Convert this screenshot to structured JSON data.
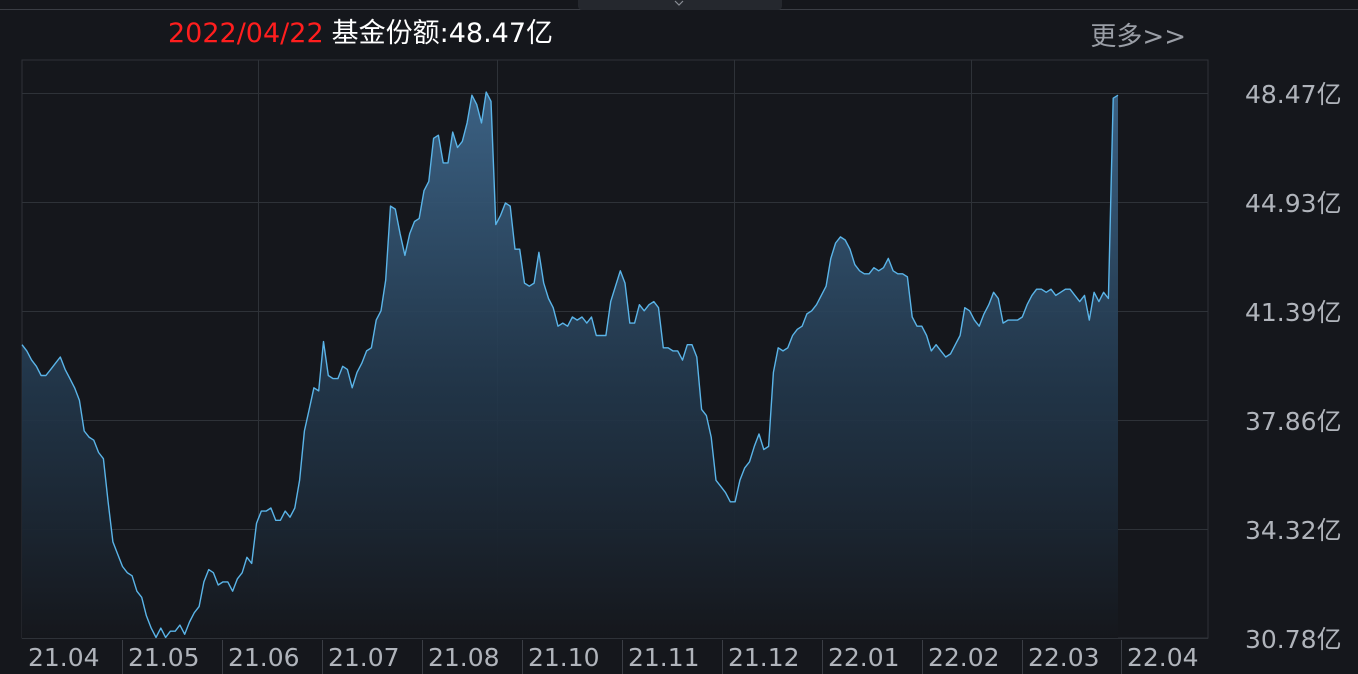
{
  "header": {
    "date": "2022/04/22",
    "label": "基金份额:",
    "value": "48.47亿",
    "more": "更多>>"
  },
  "colors": {
    "line": "#5ab4e8",
    "date": "#ff1e1e",
    "background": "#15171c",
    "grid": "#2e3238"
  },
  "icons": {
    "top_tab": "caret-down-icon"
  },
  "chart_data": {
    "type": "area",
    "title": "",
    "xlabel": "",
    "ylabel": "",
    "unit": "亿",
    "ylim": [
      30.78,
      48.47
    ],
    "grid": true,
    "y_ticks": [
      "48.47亿",
      "44.93亿",
      "41.39亿",
      "37.86亿",
      "34.32亿",
      "30.78亿"
    ],
    "y_tick_values": [
      48.47,
      44.93,
      41.39,
      37.86,
      34.32,
      30.78
    ],
    "x_ticks": [
      "21.04",
      "21.05",
      "21.06",
      "21.07",
      "21.08",
      "21.10",
      "21.11",
      "21.12",
      "22.01",
      "22.02",
      "22.03",
      "22.04"
    ],
    "series": [
      {
        "name": "",
        "values": [
          40.3,
          40.1,
          39.8,
          39.6,
          39.3,
          39.3,
          39.5,
          39.7,
          39.9,
          39.5,
          39.2,
          38.9,
          38.5,
          37.5,
          37.3,
          37.2,
          36.8,
          36.6,
          35.2,
          33.9,
          33.5,
          33.1,
          32.9,
          32.8,
          32.3,
          32.1,
          31.5,
          31.1,
          30.8,
          31.1,
          30.8,
          31.0,
          31.0,
          31.2,
          30.9,
          31.3,
          31.6,
          31.8,
          32.6,
          33.0,
          32.9,
          32.5,
          32.6,
          32.6,
          32.3,
          32.7,
          32.9,
          33.4,
          33.2,
          34.5,
          34.9,
          34.9,
          35.0,
          34.6,
          34.6,
          34.9,
          34.7,
          35.0,
          35.9,
          37.5,
          38.2,
          38.9,
          38.8,
          40.4,
          39.3,
          39.2,
          39.2,
          39.6,
          39.5,
          38.9,
          39.4,
          39.7,
          40.1,
          40.2,
          41.1,
          41.4,
          42.4,
          44.8,
          44.7,
          43.9,
          43.2,
          43.9,
          44.3,
          44.4,
          45.3,
          45.6,
          47.0,
          47.1,
          46.2,
          46.2,
          47.2,
          46.7,
          46.9,
          47.5,
          48.4,
          48.1,
          47.5,
          48.5,
          48.2,
          44.2,
          44.5,
          44.9,
          44.8,
          43.4,
          43.4,
          42.3,
          42.2,
          42.3,
          43.3,
          42.3,
          41.8,
          41.5,
          40.9,
          41.0,
          40.9,
          41.2,
          41.1,
          41.2,
          41.0,
          41.2,
          40.6,
          40.6,
          40.6,
          41.7,
          42.2,
          42.7,
          42.3,
          41.0,
          41.0,
          41.6,
          41.4,
          41.6,
          41.7,
          41.5,
          40.2,
          40.2,
          40.1,
          40.1,
          39.8,
          40.3,
          40.3,
          39.9,
          38.2,
          38.0,
          37.3,
          35.9,
          35.7,
          35.5,
          35.2,
          35.2,
          35.9,
          36.3,
          36.5,
          37.0,
          37.4,
          36.9,
          37.0,
          39.4,
          40.2,
          40.1,
          40.2,
          40.6,
          40.8,
          40.9,
          41.3,
          41.4,
          41.6,
          41.9,
          42.2,
          43.1,
          43.6,
          43.8,
          43.7,
          43.4,
          42.9,
          42.7,
          42.6,
          42.6,
          42.8,
          42.7,
          42.8,
          43.1,
          42.7,
          42.6,
          42.6,
          42.5,
          41.2,
          40.9,
          40.9,
          40.6,
          40.1,
          40.3,
          40.1,
          39.9,
          40.0,
          40.3,
          40.6,
          41.5,
          41.4,
          41.1,
          40.9,
          41.3,
          41.6,
          42.0,
          41.8,
          41.0,
          41.1,
          41.1,
          41.1,
          41.2,
          41.6,
          41.9,
          42.1,
          42.1,
          42.0,
          42.1,
          41.9,
          42.0,
          42.1,
          42.1,
          41.9,
          41.7,
          41.9,
          41.1,
          42.0,
          41.7,
          42.0,
          41.8,
          48.3,
          48.4
        ]
      }
    ]
  }
}
